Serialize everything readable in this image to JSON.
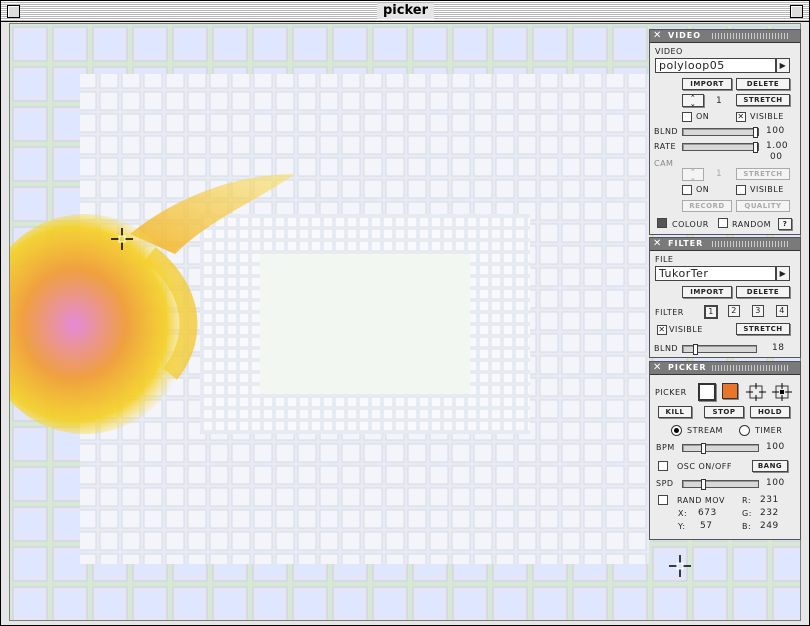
{
  "window": {
    "title": "picker"
  },
  "video": {
    "header": "VIDEO",
    "section_label": "VIDEO",
    "file": "polyloop05",
    "import": "IMPORT",
    "delete": "DELETE",
    "stepper_value": "1",
    "stretch": "STRETCH",
    "on": "ON",
    "visible": "VISIBLE",
    "blnd_label": "BLND",
    "blnd_value": "100",
    "rate_label": "RATE",
    "rate_value": "1.00",
    "extra_value": "00",
    "cam_label": "CAM",
    "cam_value": "1",
    "cam_stretch": "STRETCH",
    "cam_on": "ON",
    "cam_visible": "VISIBLE",
    "record": "RECORD",
    "quality": "QUALITY",
    "colour": "COLOUR",
    "random": "RANDOM",
    "help": "?"
  },
  "filter": {
    "header": "FILTER",
    "file_label": "FILE",
    "file": "TukorTer",
    "import": "IMPORT",
    "delete": "DELETE",
    "filter_label": "FILTER",
    "filters": [
      "1",
      "2",
      "3",
      "4"
    ],
    "visible": "VISIBLE",
    "stretch": "STRETCH",
    "blnd_label": "BLND",
    "blnd_value": "18"
  },
  "picker": {
    "header": "PICKER",
    "picker_label": "PICKER",
    "picker_color": "#e8762a",
    "kill": "KILL",
    "stop": "STOP",
    "hold": "HOLD",
    "stream": "STREAM",
    "timer": "TIMER",
    "bpm_label": "BPM",
    "bpm_value": "100",
    "osc": "OSC ON/OFF",
    "bang": "BANG",
    "spd_label": "SPD",
    "spd_value": "100",
    "randmov": "RAND MOV",
    "x_label": "X:",
    "x_value": "673",
    "y_label": "Y:",
    "y_value": "57",
    "r_label": "R:",
    "r_value": "231",
    "g_label": "G:",
    "g_value": "232",
    "b_label": "B:",
    "b_value": "249"
  }
}
